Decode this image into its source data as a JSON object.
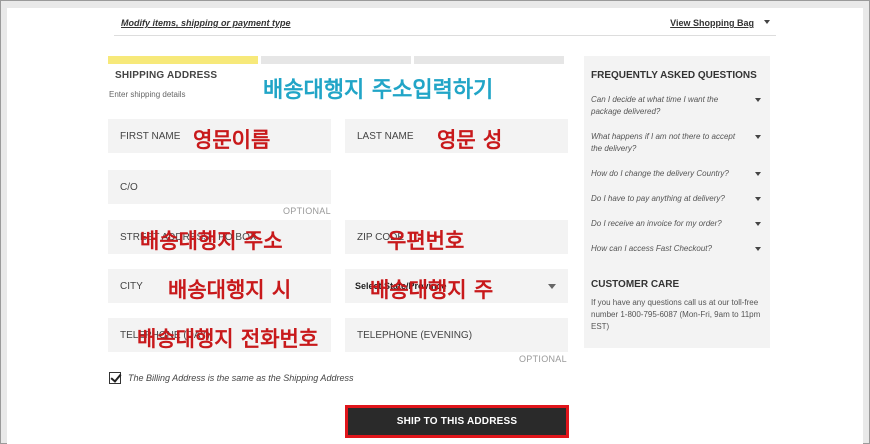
{
  "header": {
    "modify_link": "Modify items, shipping or payment type",
    "view_bag": "View Shopping Bag"
  },
  "shipping": {
    "title": "SHIPPING ADDRESS",
    "subtitle": "Enter shipping details",
    "fields": {
      "first_name": "FIRST NAME",
      "last_name": "LAST NAME",
      "co": "C/O",
      "co_optional": "OPTIONAL",
      "street": "STREET ADDRESS / PO BOX",
      "zip": "ZIP CODE",
      "city": "CITY",
      "state": "Select State/Province",
      "tel_day": "TELEPHONE (DAY)",
      "tel_evening": "TELEPHONE (EVENING)",
      "tel_optional": "OPTIONAL"
    },
    "billing_same": "The Billing Address is the same as the Shipping Address",
    "billing_same_checked": true,
    "submit": "SHIP TO THIS ADDRESS",
    "progress_active_step": 1,
    "progress_steps": 3
  },
  "annotations": {
    "title": "배송대행지 주소입력하기",
    "first_name": "영문이름",
    "last_name": "영문 성",
    "street": "배송대행지 주소",
    "zip": "우편번호",
    "city": "배송대행지 시",
    "state": "배송대행지 주",
    "phone": "배송대행지 전화번호"
  },
  "faq": {
    "title": "FREQUENTLY ASKED QUESTIONS",
    "items": [
      "Can I decide at what time I want the package delivered?",
      "What happens if I am not there to accept the delivery?",
      "How do I change the delivery Country?",
      "Do I have to pay anything at delivery?",
      "Do I receive an invoice for my order?",
      "How can I access Fast Checkout?"
    ]
  },
  "customer_care": {
    "title": "CUSTOMER CARE",
    "text": "If you have any questions call us at our toll-free number 1-800-795-6087 (Mon-Fri, 9am to 11pm EST)"
  },
  "colors": {
    "progress_active": "#f7e97a",
    "annotation_red": "#c8191b",
    "annotation_teal": "#21a5c7",
    "button_border": "#e0151b"
  }
}
